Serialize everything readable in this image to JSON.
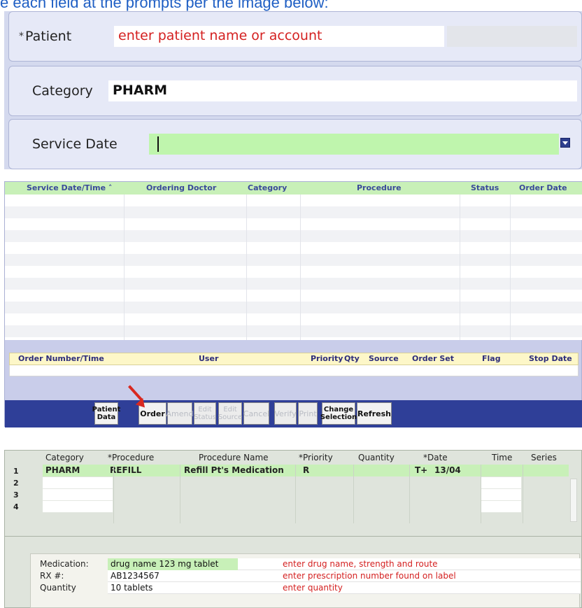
{
  "intro_text": "e each field at the prompts per the image below:",
  "form": {
    "patient": {
      "required_mark": "*",
      "label": "Patient",
      "placeholder": "enter patient name or account"
    },
    "category": {
      "label": "Category",
      "value": "PHARM"
    },
    "service_date": {
      "label": "Service Date",
      "value": ""
    }
  },
  "orders": {
    "columns": [
      "Service Date/Time",
      "Ordering Doctor",
      "Category",
      "Procedure",
      "Status",
      "Order Date"
    ],
    "sort_indicator": "˄",
    "detail_columns": [
      "Order Number/Time",
      "User",
      "Priority",
      "Qty",
      "Source",
      "Order Set",
      "Flag",
      "Stop Date"
    ],
    "buttons": [
      {
        "label": "Patient\nData",
        "enabled": true
      },
      {
        "label": "Order",
        "enabled": true
      },
      {
        "label": "Amend",
        "enabled": false
      },
      {
        "label": "Edit\nStatus",
        "enabled": false
      },
      {
        "label": "Edit\nSource",
        "enabled": false
      },
      {
        "label": "Cancel",
        "enabled": false
      },
      {
        "label": "Verify",
        "enabled": false
      },
      {
        "label": "Print",
        "enabled": false
      },
      {
        "label": "Change\nSelection",
        "enabled": true
      },
      {
        "label": "Refresh",
        "enabled": true
      }
    ],
    "pointer_color": "#d9281f"
  },
  "procedures": {
    "columns": [
      "Category",
      "*Procedure",
      "Procedure Name",
      "*Priority",
      "Quantity",
      "*Date",
      "Time",
      "Series"
    ],
    "row_numbers": [
      "1",
      "2",
      "3",
      "4"
    ],
    "row1": {
      "category": "PHARM",
      "procedure": "REFILL",
      "procedure_name": "Refill Pt's Medication",
      "priority": "R",
      "date_prefix": "T+",
      "date": "13/04"
    }
  },
  "medication": {
    "medication_label": "Medication:",
    "medication_value": "drug name 123 mg tablet",
    "medication_hint": "enter drug name, strength and route",
    "rx_label": "RX #:",
    "rx_value": "AB1234567",
    "rx_hint": "enter prescription number found on label",
    "quantity_label": "Quantity",
    "quantity_value": "10 tablets",
    "quantity_hint": "enter quantity"
  },
  "colors": {
    "header_green": "#c8f0b8",
    "toolbar_blue": "#2f3f98",
    "hint_red": "#d42020",
    "form_panel": "#d4d9ee"
  }
}
